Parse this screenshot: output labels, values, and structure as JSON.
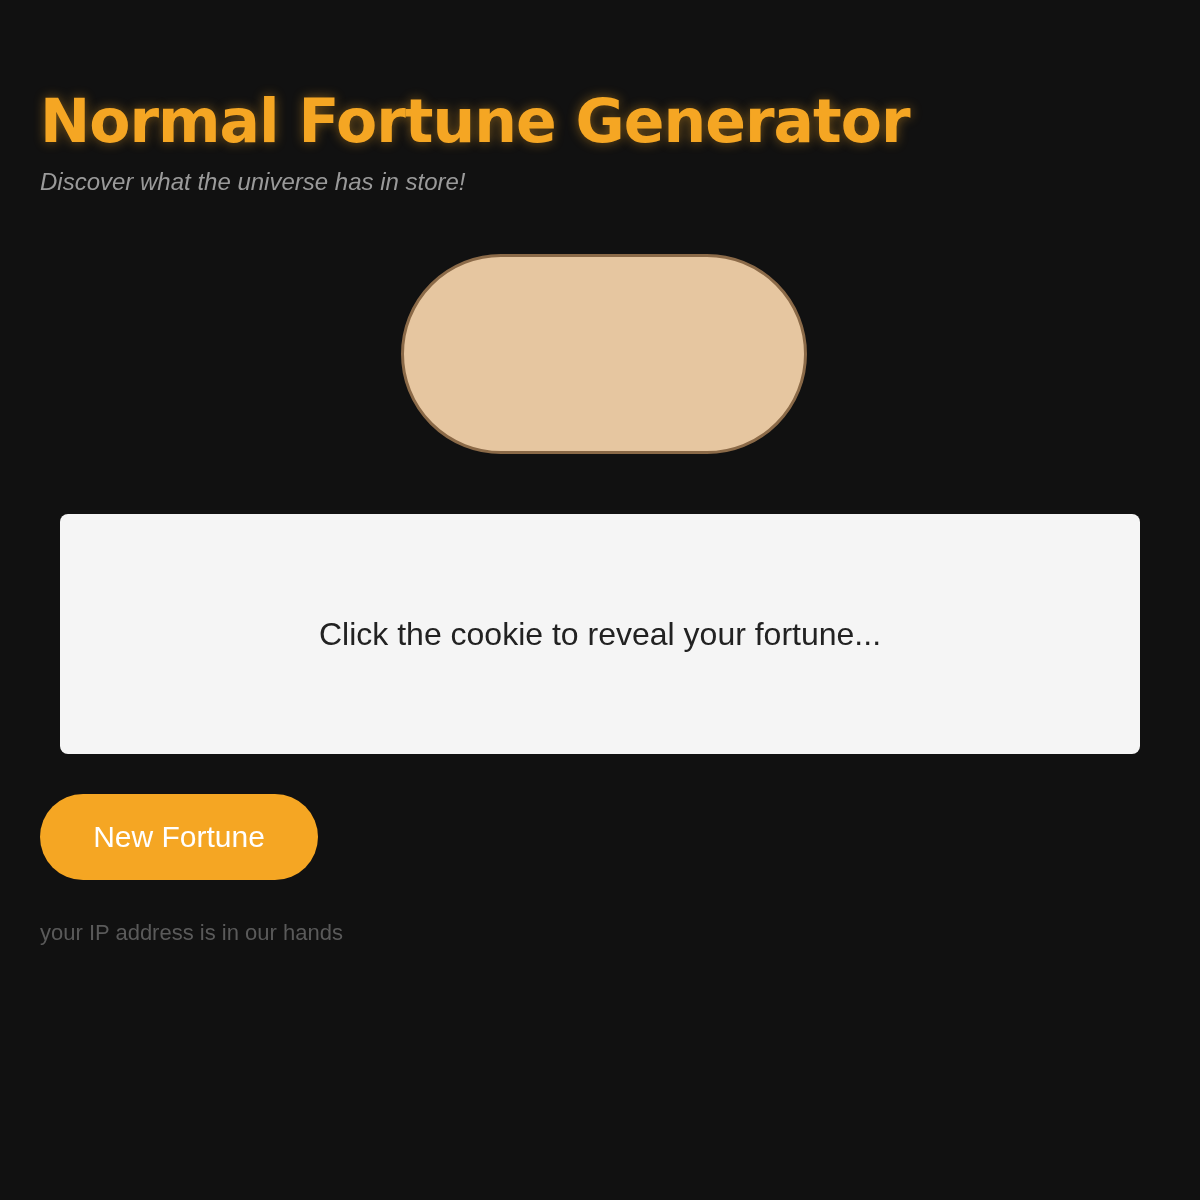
{
  "header": {
    "title": "Normal Fortune Generator",
    "subtitle": "Discover what the universe has in store!"
  },
  "fortune": {
    "message": "Click the cookie to reveal your fortune..."
  },
  "button": {
    "label": "New Fortune"
  },
  "footer": {
    "note": "your IP address is in our hands"
  }
}
